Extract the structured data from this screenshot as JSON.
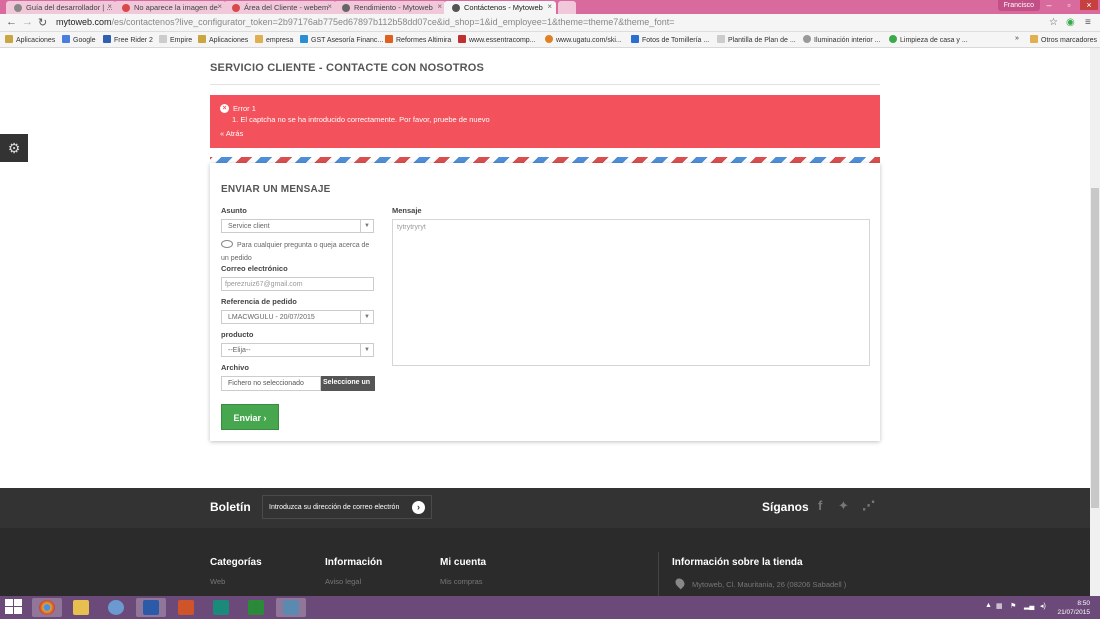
{
  "browser": {
    "tabs": [
      {
        "label": "Guía del desarrollador | ..."
      },
      {
        "label": "No aparece la imagen de"
      },
      {
        "label": "Área del Cliente - webem"
      },
      {
        "label": "Rendimiento - Mytoweb"
      },
      {
        "label": "Contáctenos - Mytoweb"
      }
    ],
    "user_name": "Francisco",
    "url_domain": "mytoweb.com",
    "url_path": "/es/contactenos?live_configurator_token=2b97176ab775ed67897b112b58dd07ce&id_shop=1&id_employee=1&theme=theme7&theme_font=",
    "bookmarks": [
      "Aplicaciones",
      "Google",
      "Free Rider 2",
      "Empire",
      "Aplicaciones",
      "empresa",
      "GST Asesoría Financ...",
      "Reformes Altimira",
      "www.essentracomp...",
      "www.ugatu.com/ski...",
      "Fotos de Tornillería ...",
      "Plantilla de Plan de ...",
      "Iluminación interior ...",
      "Limpieza de casa y ...",
      "»",
      "Otros marcadores"
    ],
    "colors": {
      "tabbar": "#d86a9e",
      "taskbar": "#6b4a79"
    }
  },
  "page": {
    "heading": "SERVICIO CLIENTE - CONTACTE CON NOSOTROS",
    "error": {
      "title": "Error 1",
      "item": "1.   El captcha no se ha introducido correctamente. Por favor, pruebe de nuevo",
      "back": "« Atrás",
      "color": "#f3515c"
    },
    "form": {
      "title": "ENVIAR UN MENSAJE",
      "subject_label": "Asunto",
      "subject_value": "Service client",
      "subject_help": "Para cualquier pregunta o queja acerca de un pedido",
      "email_label": "Correo electrónico",
      "email_value": "fperezruiz67@gmail.com",
      "order_label": "Referencia de pedido",
      "order_value": "LMACWGULU - 20/07/2015",
      "product_label": "producto",
      "product_value": "--Elija--",
      "file_label": "Archivo",
      "file_name": "Fichero no seleccionado",
      "file_button": "Seleccione un",
      "message_label": "Mensaje",
      "message_value": "tytrytryryt",
      "send_label": "Enviar",
      "send_color": "#46a74e"
    },
    "newsletter": {
      "title": "Boletín",
      "placeholder": "Introduzca su dirección de correo electrón"
    },
    "follow": {
      "title": "Síganos",
      "icons": [
        "facebook-icon",
        "twitter-icon",
        "rss-icon"
      ]
    },
    "footer": {
      "columns": [
        {
          "title": "Categorías",
          "link": "Web"
        },
        {
          "title": "Información",
          "link": "Aviso legal"
        },
        {
          "title": "Mi cuenta",
          "link": "Mis compras"
        }
      ],
      "store_title": "Información sobre la tienda",
      "store_address": "Mytoweb, Cl. Mauritania, 26 (08206 Sabadell )"
    }
  },
  "taskbar": {
    "time": "8:50",
    "date": "21/07/2015"
  }
}
